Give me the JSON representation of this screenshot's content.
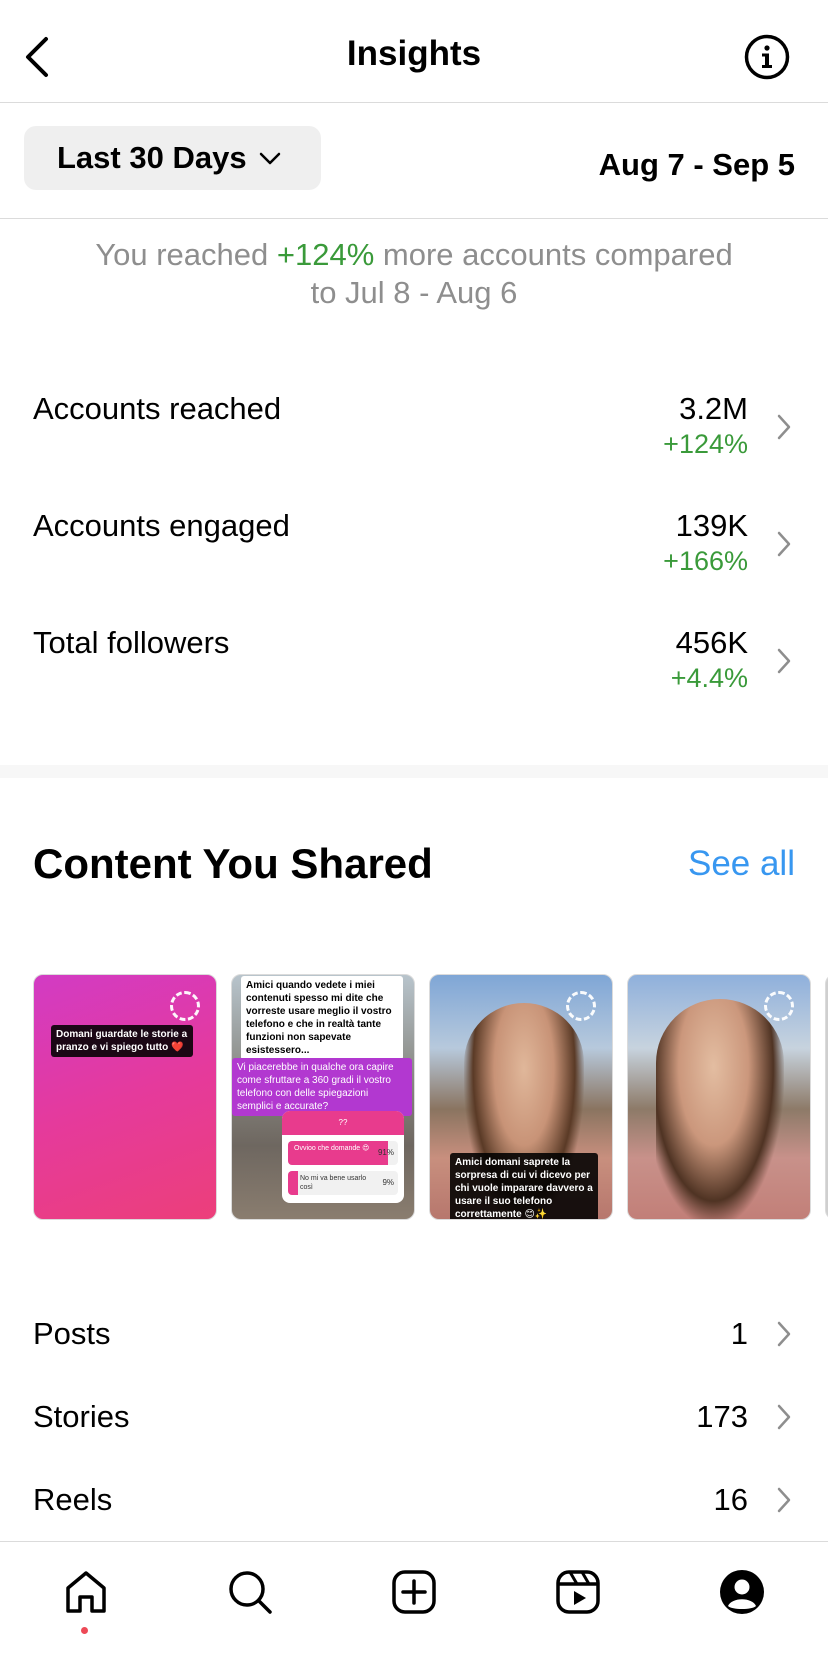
{
  "header": {
    "title": "Insights",
    "back_icon": "chevron-left-icon",
    "info_icon": "info-icon"
  },
  "range": {
    "selected": "Last 30 Days",
    "dates": "Aug 7 - Sep 5"
  },
  "compare": {
    "prefix": "You reached",
    "pct": "+124%",
    "suffix_line1": "more accounts compared",
    "suffix_line2": "to Jul 8 - Aug 6"
  },
  "metrics": [
    {
      "label": "Accounts reached",
      "value": "3.2M",
      "delta": "+124%"
    },
    {
      "label": "Accounts engaged",
      "value": "139K",
      "delta": "+166%"
    },
    {
      "label": "Total followers",
      "value": "456K",
      "delta": "+4.4%"
    }
  ],
  "content": {
    "title": "Content You Shared",
    "see_all": "See all",
    "thumbs": [
      {
        "caption": "Domani guardate le storie a pranzo e vi spiego tutto ❤️"
      },
      {
        "caption_top": "Amici quando vedete i miei contenuti spesso mi dite che vorreste usare meglio il vostro telefono e che in realtà tante funzioni non sapevate esistessero...",
        "caption_mid": "Vi piacerebbe in qualche ora capire come sfruttare a 360 gradi il vostro telefono con delle spiegazioni semplici e accurate?",
        "poll_q": "??",
        "poll_opt1": "Ovvioo che domande 😍",
        "poll_pct1": "91%",
        "poll_opt2": "No mi va bene usarlo così",
        "poll_pct2": "9%"
      },
      {
        "caption": "Amici domani saprete la sorpresa di cui vi dicevo per chi vuole imparare davvero a usare il suo telefono correttamente 😊✨"
      },
      {
        "caption": ""
      }
    ]
  },
  "counts": [
    {
      "label": "Posts",
      "value": "1"
    },
    {
      "label": "Stories",
      "value": "173"
    },
    {
      "label": "Reels",
      "value": "16"
    }
  ],
  "tabbar": {
    "items": [
      "home-icon",
      "search-icon",
      "create-icon",
      "reels-icon",
      "profile-icon"
    ]
  },
  "colors": {
    "positive": "#3a9a3a",
    "link": "#3897f0",
    "muted": "#8e8e8e"
  }
}
